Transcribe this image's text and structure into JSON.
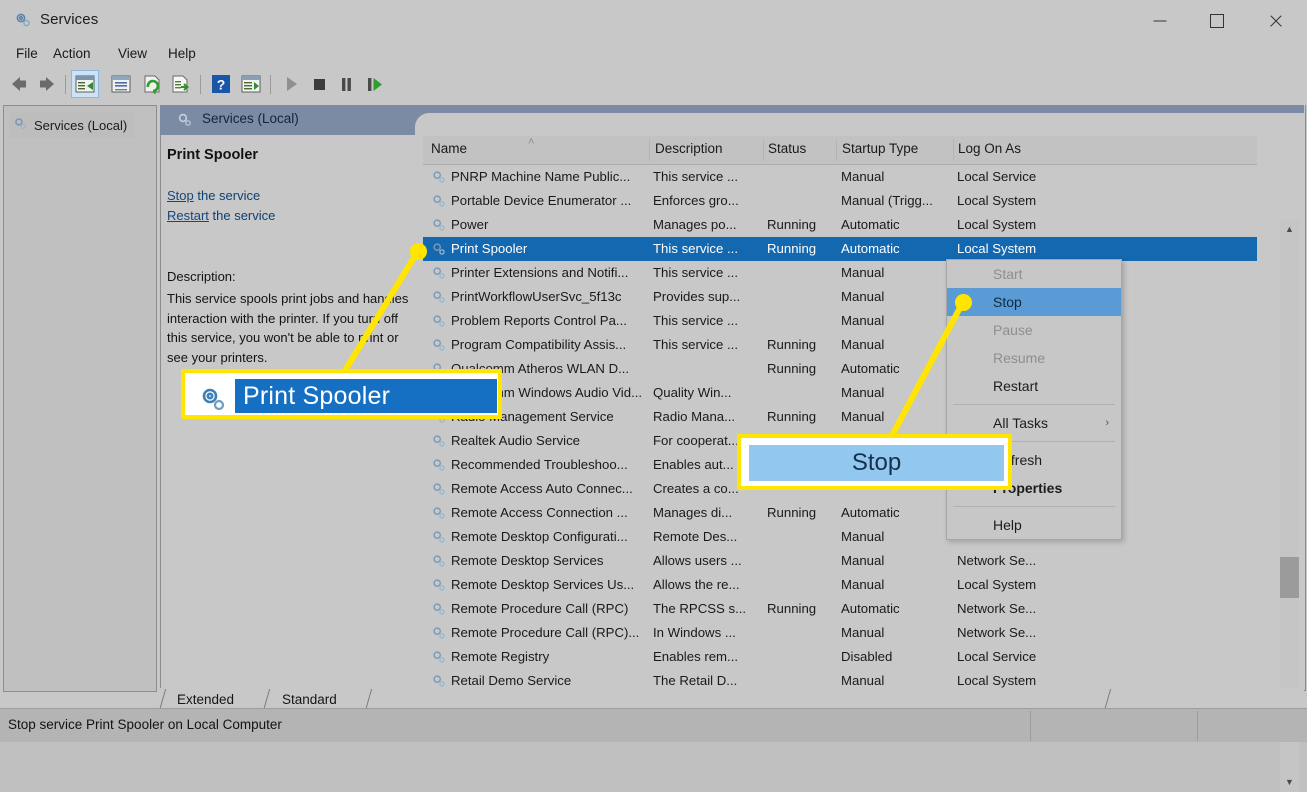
{
  "window": {
    "title": "Services",
    "icon": "services-gear-icon",
    "controls": {
      "minimize": "minimize-icon",
      "maximize": "maximize-icon",
      "close": "close-icon"
    }
  },
  "menubar": {
    "items": [
      "File",
      "Action",
      "View",
      "Help"
    ]
  },
  "toolbar": {
    "items": [
      "back-icon",
      "forward-icon",
      "show-hide-console-tree-icon",
      "properties-icon",
      "refresh-icon",
      "export-list-icon",
      "help-icon",
      "show-hide-action-pane-icon",
      "start-service-icon",
      "stop-service-icon",
      "pause-service-icon",
      "restart-service-icon"
    ]
  },
  "tree": {
    "item_label": "Services (Local)"
  },
  "pane_header": {
    "title": "Services (Local)",
    "icon": "services-gear-icon"
  },
  "detail": {
    "service_name": "Print Spooler",
    "stop_link": "Stop",
    "stop_suffix": " the service",
    "restart_link": "Restart",
    "restart_suffix": " the service",
    "description_label": "Description:",
    "description_text": "This service spools print jobs and handles interaction with the printer. If you turn off this service, you won't be able to print or see your printers."
  },
  "list": {
    "columns": [
      "Name",
      "Description",
      "Status",
      "Startup Type",
      "Log On As"
    ],
    "sort_column": "Name",
    "sort_indicator": "˄",
    "rows": [
      {
        "name": "PNRP Machine Name Public...",
        "desc": "This service ...",
        "status": "",
        "startup": "Manual",
        "logon": "Local Service",
        "selected": false
      },
      {
        "name": "Portable Device Enumerator ...",
        "desc": "Enforces gro...",
        "status": "",
        "startup": "Manual (Trigg...",
        "logon": "Local System",
        "selected": false
      },
      {
        "name": "Power",
        "desc": "Manages po...",
        "status": "Running",
        "startup": "Automatic",
        "logon": "Local System",
        "selected": false
      },
      {
        "name": "Print Spooler",
        "desc": "This service ...",
        "status": "Running",
        "startup": "Automatic",
        "logon": "Local System",
        "selected": true
      },
      {
        "name": "Printer Extensions and Notifi...",
        "desc": "This service ...",
        "status": "",
        "startup": "Manual",
        "logon": "",
        "selected": false
      },
      {
        "name": "PrintWorkflowUserSvc_5f13c",
        "desc": "Provides sup...",
        "status": "",
        "startup": "Manual",
        "logon": "",
        "selected": false
      },
      {
        "name": "Problem Reports Control Pa...",
        "desc": "This service ...",
        "status": "",
        "startup": "Manual",
        "logon": "",
        "selected": false
      },
      {
        "name": "Program Compatibility Assis...",
        "desc": "This service ...",
        "status": "Running",
        "startup": "Manual",
        "logon": "",
        "selected": false
      },
      {
        "name": "Qualcomm Atheros WLAN D...",
        "desc": "",
        "status": "Running",
        "startup": "Automatic",
        "logon": "",
        "selected": false
      },
      {
        "name": "Qualcomm Windows Audio Vid...",
        "desc": "Quality Win...",
        "status": "",
        "startup": "Manual",
        "logon": "",
        "selected": false
      },
      {
        "name": "Radio Management Service",
        "desc": "Radio Mana...",
        "status": "Running",
        "startup": "Manual",
        "logon": "",
        "selected": false
      },
      {
        "name": "Realtek Audio Service",
        "desc": "For cooperat...",
        "status": "",
        "startup": "",
        "logon": "",
        "selected": false
      },
      {
        "name": "Recommended Troubleshoo...",
        "desc": "Enables aut...",
        "status": "",
        "startup": "",
        "logon": "",
        "selected": false
      },
      {
        "name": "Remote Access Auto Connec...",
        "desc": "Creates a co...",
        "status": "",
        "startup": "",
        "logon": "",
        "selected": false
      },
      {
        "name": "Remote Access Connection ...",
        "desc": "Manages di...",
        "status": "Running",
        "startup": "Automatic",
        "logon": "",
        "selected": false
      },
      {
        "name": "Remote Desktop Configurati...",
        "desc": "Remote Des...",
        "status": "",
        "startup": "Manual",
        "logon": "",
        "selected": false
      },
      {
        "name": "Remote Desktop Services",
        "desc": "Allows users ...",
        "status": "",
        "startup": "Manual",
        "logon": "Network Se...",
        "selected": false
      },
      {
        "name": "Remote Desktop Services Us...",
        "desc": "Allows the re...",
        "status": "",
        "startup": "Manual",
        "logon": "Local System",
        "selected": false
      },
      {
        "name": "Remote Procedure Call (RPC)",
        "desc": "The RPCSS s...",
        "status": "Running",
        "startup": "Automatic",
        "logon": "Network Se...",
        "selected": false
      },
      {
        "name": "Remote Procedure Call (RPC)...",
        "desc": "In Windows ...",
        "status": "",
        "startup": "Manual",
        "logon": "Network Se...",
        "selected": false
      },
      {
        "name": "Remote Registry",
        "desc": "Enables rem...",
        "status": "",
        "startup": "Disabled",
        "logon": "Local Service",
        "selected": false
      },
      {
        "name": "Retail Demo Service",
        "desc": "The Retail D...",
        "status": "",
        "startup": "Manual",
        "logon": "Local System",
        "selected": false
      }
    ]
  },
  "context_menu": {
    "items": [
      {
        "label": "Start",
        "state": "disabled",
        "separator_after": false
      },
      {
        "label": "Stop",
        "state": "highlighted",
        "separator_after": false
      },
      {
        "label": "Pause",
        "state": "disabled",
        "separator_after": false
      },
      {
        "label": "Resume",
        "state": "disabled",
        "separator_after": false
      },
      {
        "label": "Restart",
        "state": "normal",
        "separator_after": true
      },
      {
        "label": "All Tasks",
        "state": "submenu",
        "separator_after": true
      },
      {
        "label": "Refresh",
        "state": "normal",
        "separator_after": false
      },
      {
        "label": "Properties",
        "state": "bold",
        "separator_after": true
      },
      {
        "label": "Help",
        "state": "normal",
        "separator_after": false
      }
    ],
    "submenu_arrow": "›"
  },
  "tabs": {
    "items": [
      "Extended",
      "Standard"
    ],
    "active": "Standard"
  },
  "statusbar": {
    "text": "Stop service Print Spooler on Local Computer"
  },
  "callouts": {
    "service_zoom": {
      "label": "Print Spooler",
      "icon": "services-gear-icon"
    },
    "menu_zoom": {
      "label": "Stop"
    },
    "highlight_color": "#ffe500"
  },
  "colors": {
    "selection_blue": "#1468b0",
    "menu_highlight_blue": "#5b9bd5",
    "pane_header": "#7b8ba3",
    "window_chrome": "#c8c8c8",
    "annotation_yellow": "#ffe500"
  }
}
